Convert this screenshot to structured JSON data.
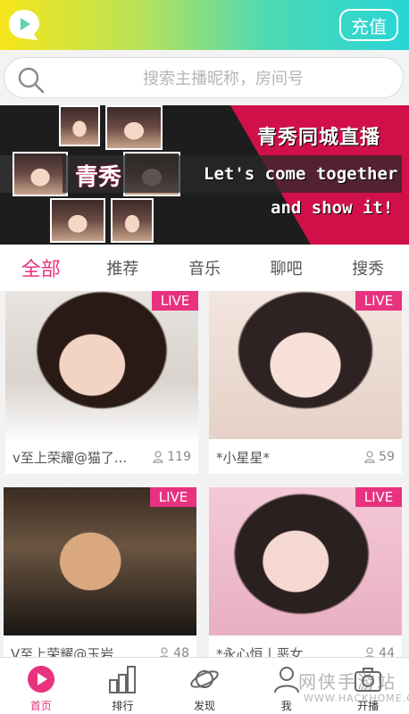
{
  "colors": {
    "accent": "#e8327f",
    "banner_red": "#d1104a"
  },
  "header": {
    "logo_icon": "chat-bubble-play-icon",
    "recharge_label": "充值"
  },
  "search": {
    "placeholder": "搜索主播昵称，房间号",
    "icon": "search-icon"
  },
  "banner": {
    "title": "青秀同城直播",
    "brand": "青秀",
    "line1": "Let's come together",
    "line2": "and show it!"
  },
  "tabs": [
    {
      "label": "全部",
      "active": true
    },
    {
      "label": "推荐",
      "active": false
    },
    {
      "label": "音乐",
      "active": false
    },
    {
      "label": "聊吧",
      "active": false
    },
    {
      "label": "搜秀",
      "active": false
    }
  ],
  "cards": [
    {
      "name": "v至上荣耀@猫了...",
      "viewers": "119",
      "badge": "LIVE"
    },
    {
      "name": "*小星星*",
      "viewers": "59",
      "badge": "LIVE"
    },
    {
      "name": "V至上荣耀@玉岩",
      "viewers": "48",
      "badge": "LIVE"
    },
    {
      "name": "*永心恒丨恶女",
      "viewers": "44",
      "badge": "LIVE"
    }
  ],
  "nav": [
    {
      "label": "首页",
      "icon": "home-play-icon",
      "active": true
    },
    {
      "label": "排行",
      "icon": "bar-chart-icon",
      "active": false
    },
    {
      "label": "发现",
      "icon": "planet-icon",
      "active": false
    },
    {
      "label": "我",
      "icon": "user-icon",
      "active": false
    },
    {
      "label": "开播",
      "icon": "camera-icon",
      "active": false
    }
  ],
  "watermark": {
    "line1": "网侠手游站",
    "line2": "WWW.HACKHOME.COM"
  }
}
